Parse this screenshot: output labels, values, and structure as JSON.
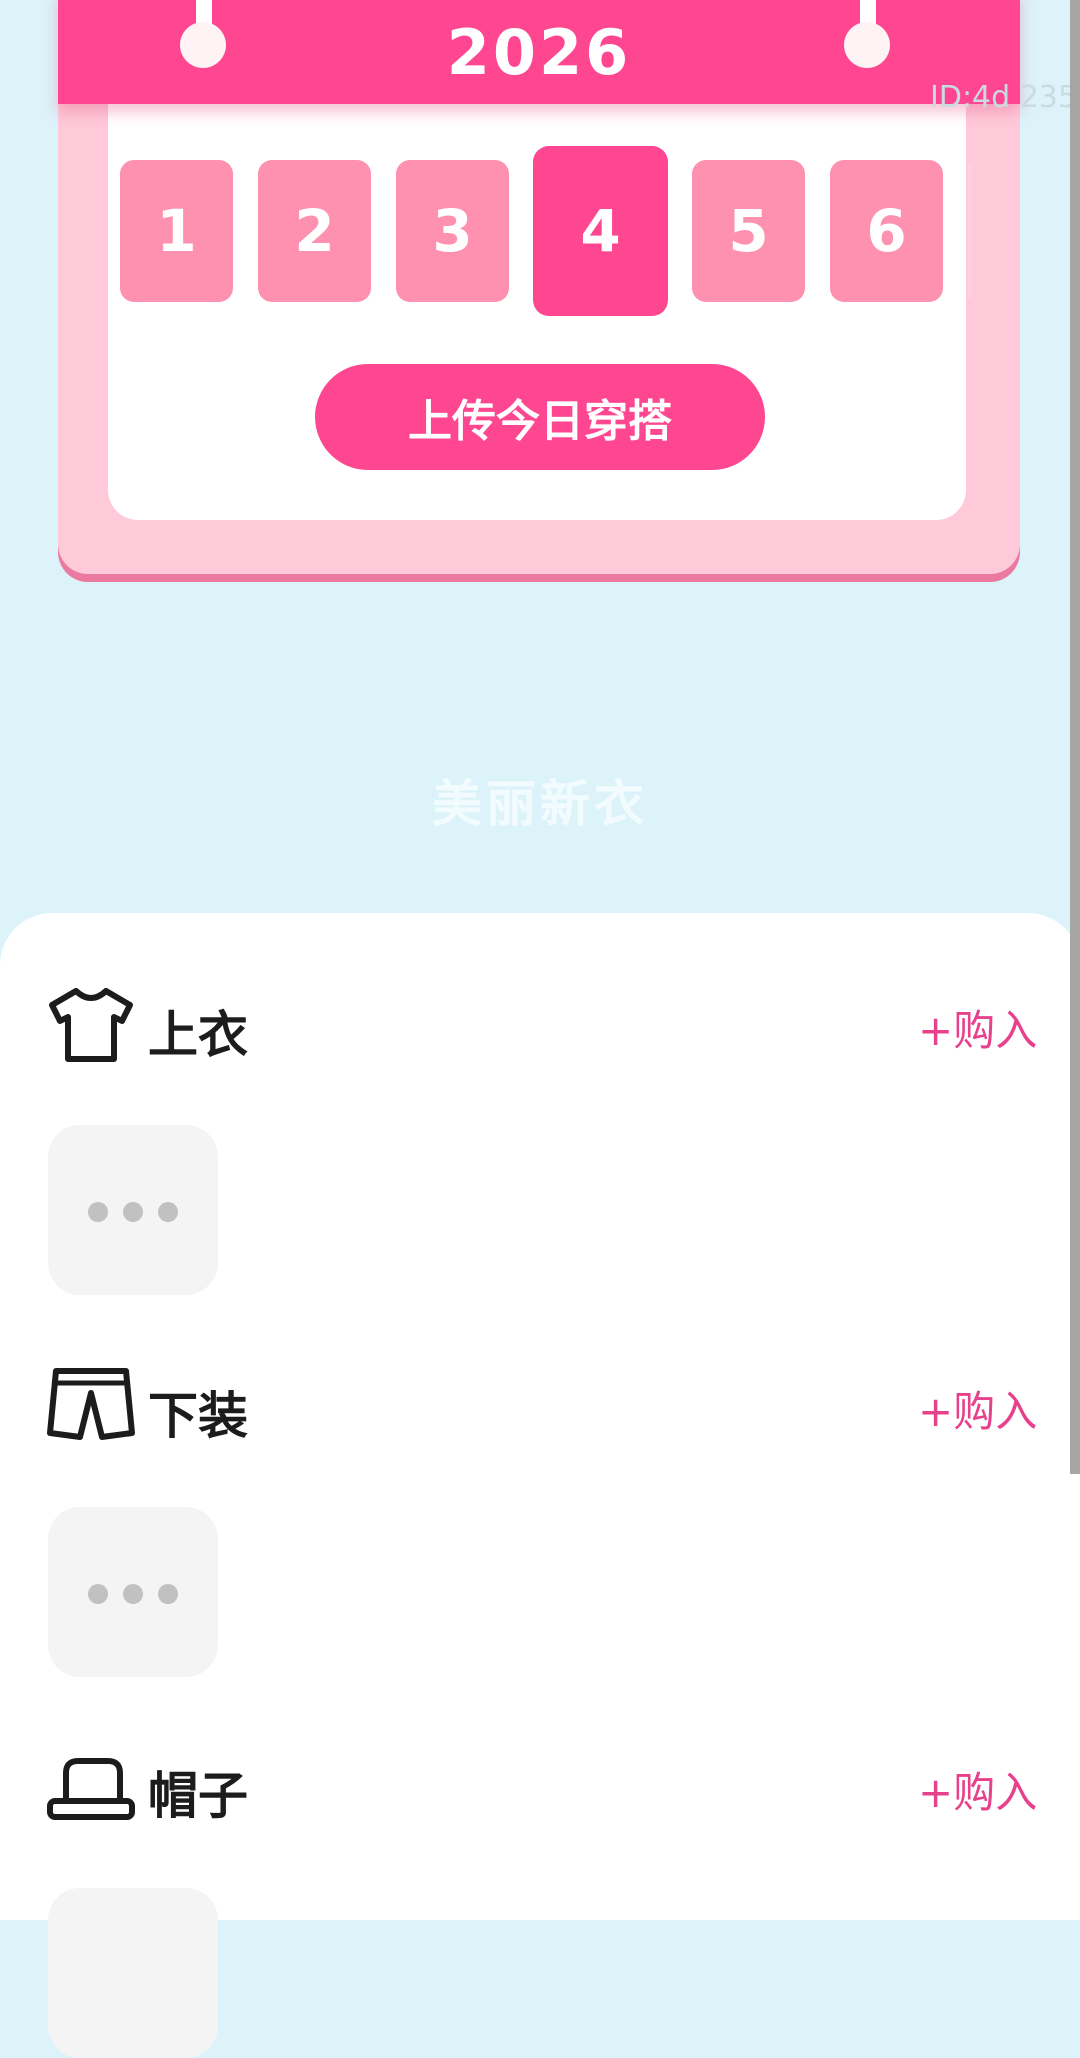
{
  "calendar": {
    "year": "2026",
    "days": [
      "1",
      "2",
      "3",
      "4",
      "5",
      "6"
    ],
    "selected_day": "4",
    "upload_label": "上传今日穿搭"
  },
  "watermark": "ID:4d 235",
  "section_title": "美丽新衣",
  "categories": [
    {
      "label": "上衣",
      "buy_label": "+购入",
      "icon": "tshirt-icon"
    },
    {
      "label": "下装",
      "buy_label": "+购入",
      "icon": "shorts-icon"
    },
    {
      "label": "帽子",
      "buy_label": "+购入",
      "icon": "hat-icon"
    }
  ],
  "colors": {
    "accent": "#fe4790",
    "day_tile": "#fe91b0",
    "background": "#dcf3fa",
    "buy_link": "#e8418b"
  }
}
